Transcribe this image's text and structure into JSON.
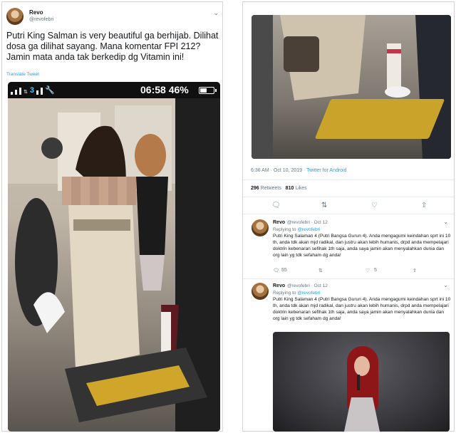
{
  "left": {
    "author": {
      "name": "Revo",
      "handle": "@revofebri"
    },
    "text": "Putri King Salman is very beautiful ga berhijab. Dilihat dosa ga dilihat sayang. Mana komentar FPI 212? Jamin mata anda tak berkedip dg Vitamin ini!",
    "translate_label": "Translate Tweet",
    "phone": {
      "time": "06:58",
      "battery": "46%",
      "battery_level": 0.46,
      "network_badge": "3"
    }
  },
  "right": {
    "meta": {
      "timestamp": "6:36 AM · Oct 10, 2019 · ",
      "source": "Twitter for Android"
    },
    "stats": {
      "retweets": "296",
      "retweets_label": "Retweets",
      "likes": "810",
      "likes_label": "Likes"
    },
    "replies": [
      {
        "name": "Revo",
        "handle": "@revofebri · Oct 12",
        "replying_label": "Replying to ",
        "replying_to": "@revofebri",
        "text": "Putri King Salaman 4 (Putri Bangsa Gurun 4). Anda mengagumi keindahan sprt ini 10 th, anda tdk akan mjd radikal, dan justru akan lebih humanis, drpd anda mempelajari doktrin kebenaran sefihak 1th saja, anda saya jamin akan menyalahkan dunia dan org lain yg tdk sefaham dg anda!",
        "reply_count": "55",
        "like_count": "5"
      },
      {
        "name": "Revo",
        "handle": "@revofebri · Oct 12",
        "replying_label": "Replying to ",
        "replying_to": "@revofebri",
        "text": "Putri King Salaman 4 (Putri Bangsa Gurun 4). Anda mengagumi keindahan sprt ini 10 th, anda tdk akan mjd radikal, dan justru akan lebih humanis, drpd anda mempelajari doktrin kebenaran sefihak 1th saja, anda saya jamin akan menyalahkan dunia dan org lain yg tdk sefaham dg anda!"
      }
    ]
  },
  "icons": {
    "reply": "reply-icon",
    "retweet": "retweet-icon",
    "like": "heart-icon",
    "share": "share-icon",
    "caret": "chevron-down-icon"
  },
  "colors": {
    "link": "#1da1f2",
    "secondary": "#657786",
    "text": "#14171a"
  }
}
